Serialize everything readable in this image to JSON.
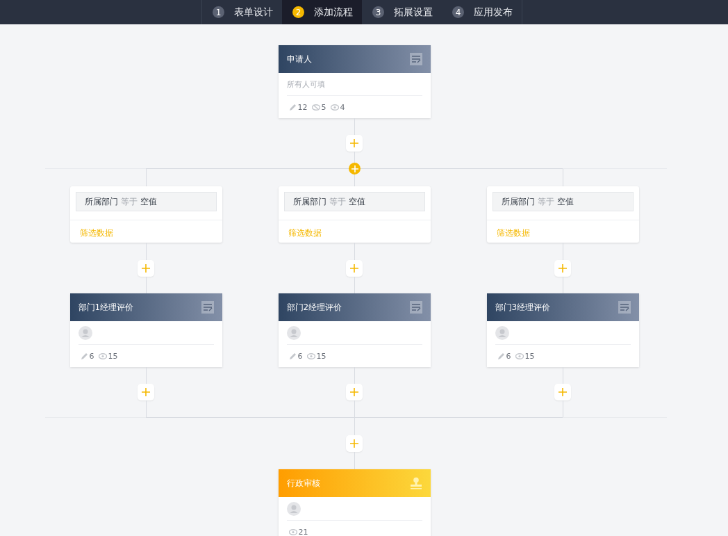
{
  "steps": [
    {
      "number": "1",
      "label": "表单设计",
      "selected": false
    },
    {
      "number": "2",
      "label": "添加流程",
      "selected": true
    },
    {
      "number": "3",
      "label": "拓展设置",
      "selected": false
    },
    {
      "number": "4",
      "label": "应用发布",
      "selected": false
    }
  ],
  "start_node": {
    "kind": "fill",
    "title": "申请人",
    "subtitle": "所有人可填",
    "avatar": false,
    "stats": [
      {
        "kind": "edit",
        "value": "12"
      },
      {
        "kind": "hidden",
        "value": "5"
      },
      {
        "kind": "view",
        "value": "4"
      }
    ]
  },
  "branches": [
    {
      "condition": {
        "field": "所属部门",
        "operator": "等于",
        "value": "空值"
      },
      "filter_link": "筛选数据",
      "approver": {
        "kind": "fill",
        "title": "部门1经理评价",
        "avatar": true,
        "stats": [
          {
            "kind": "edit",
            "value": "6"
          },
          {
            "kind": "view",
            "value": "15"
          }
        ]
      }
    },
    {
      "condition": {
        "field": "所属部门",
        "operator": "等于",
        "value": "空值"
      },
      "filter_link": "筛选数据",
      "approver": {
        "kind": "fill",
        "title": "部门2经理评价",
        "avatar": true,
        "stats": [
          {
            "kind": "edit",
            "value": "6"
          },
          {
            "kind": "view",
            "value": "15"
          }
        ]
      }
    },
    {
      "condition": {
        "field": "所属部门",
        "operator": "等于",
        "value": "空值"
      },
      "filter_link": "筛选数据",
      "approver": {
        "kind": "fill",
        "title": "部门3经理评价",
        "avatar": true,
        "stats": [
          {
            "kind": "edit",
            "value": "6"
          },
          {
            "kind": "view",
            "value": "15"
          }
        ]
      }
    }
  ],
  "end_node": {
    "kind": "approve",
    "title": "行政审核",
    "avatar": true,
    "stats": [
      {
        "kind": "view",
        "value": "21"
      }
    ]
  }
}
